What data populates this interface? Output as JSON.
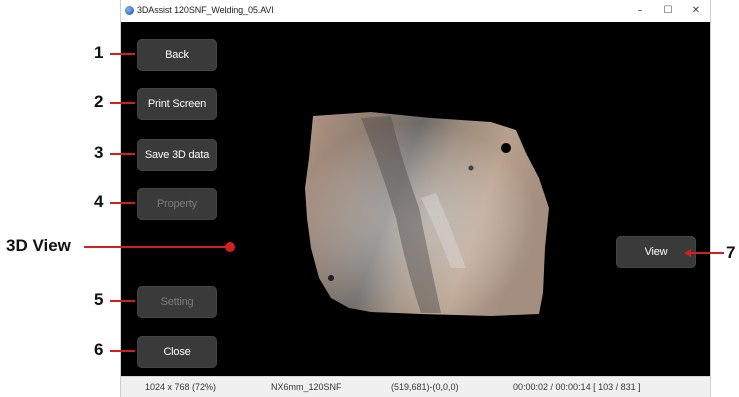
{
  "window": {
    "title": "3DAssist 120SNF_Welding_05.AVI",
    "controls": {
      "minimize": "–",
      "maximize": "☐",
      "close": "✕"
    }
  },
  "buttons": {
    "back": "Back",
    "print_screen": "Print Screen",
    "save_3d": "Save 3D data",
    "property": "Property",
    "setting": "Setting",
    "close": "Close",
    "view": "View"
  },
  "button_states": {
    "property": "disabled",
    "setting": "disabled"
  },
  "status": {
    "resolution": "1024 x 768 (72%)",
    "probe": "NX6mm_120SNF",
    "coords": "(519,681)-(0,0,0)",
    "time": "00:00:02 / 00:00:14  [ 103 / 831 ]"
  },
  "callouts": {
    "c1": "1",
    "c2": "2",
    "c3": "3",
    "c4": "4",
    "view3d": "3D View",
    "c5": "5",
    "c6": "6",
    "c7": "7"
  },
  "colors": {
    "callout": "#d0201f",
    "button": "#3a3a3a",
    "background": "#000000"
  },
  "icons": {
    "app": "app-logo-icon"
  }
}
